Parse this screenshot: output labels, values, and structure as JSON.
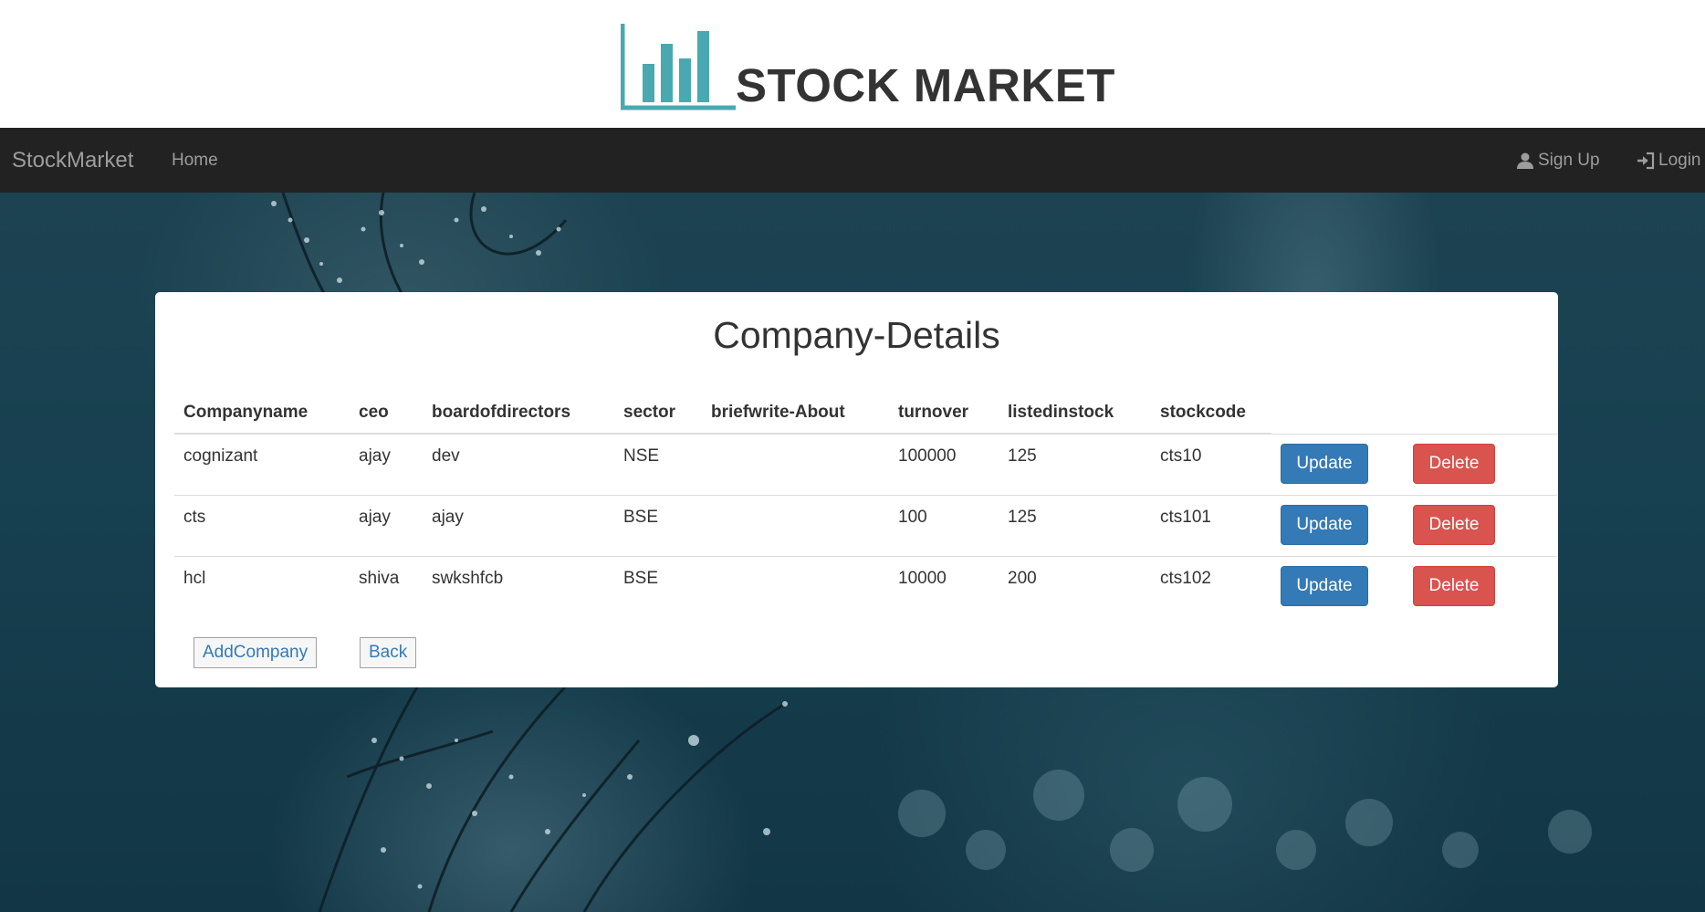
{
  "logo": {
    "text": "STOCK MARKET",
    "icon": "bar-chart-logo-icon",
    "color": "#4aa8b0"
  },
  "navbar": {
    "brand": "StockMarket",
    "home": "Home",
    "signup": "Sign Up",
    "signup_icon": "user-icon",
    "login": "Login",
    "login_icon": "log-in-icon"
  },
  "page": {
    "title": "Company-Details"
  },
  "table": {
    "columns": [
      "Companyname",
      "ceo",
      "boardofdirectors",
      "sector",
      "briefwrite-About",
      "turnover",
      "listedinstock",
      "stockcode"
    ],
    "rows": [
      [
        "cognizant",
        "ajay",
        "dev",
        "NSE",
        "",
        "100000",
        "125",
        "cts10"
      ],
      [
        "cts",
        "ajay",
        "ajay",
        "BSE",
        "",
        "100",
        "125",
        "cts101"
      ],
      [
        "hcl",
        "shiva",
        "swkshfcb",
        "BSE",
        "",
        "10000",
        "200",
        "cts102"
      ]
    ],
    "update_label": "Update",
    "delete_label": "Delete"
  },
  "actions": {
    "add_company": "AddCompany",
    "back": "Back"
  },
  "colors": {
    "navbar": "#222222",
    "update": "#337ab7",
    "delete": "#d9534f",
    "link": "#337ab7"
  }
}
